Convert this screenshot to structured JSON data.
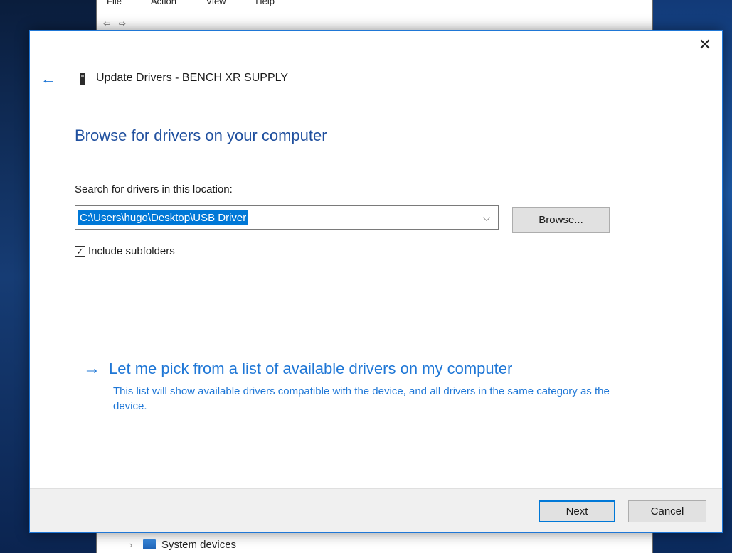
{
  "background_window": {
    "menu": [
      "File",
      "Action",
      "View",
      "Help"
    ],
    "tree_row_label": "System devices"
  },
  "dialog": {
    "title": "Update Drivers - BENCH XR SUPPLY",
    "heading": "Browse for drivers on your computer",
    "search_label": "Search for drivers in this location:",
    "path_value": "C:\\Users\\hugo\\Desktop\\USB Driver",
    "browse_label": "Browse...",
    "include_subfolders_label": "Include subfolders",
    "include_subfolders_checked": true,
    "pick_link_label": "Let me pick from a list of available drivers on my computer",
    "pick_description": "This list will show available drivers compatible with the device, and all drivers in the same category as the device.",
    "next_label": "Next",
    "cancel_label": "Cancel",
    "close_glyph": "✕",
    "back_glyph": "←",
    "arrow_glyph": "→",
    "chevron_glyph": "⌵",
    "check_glyph": "✓"
  },
  "colors": {
    "accent": "#0078d7",
    "heading": "#1f4f9e",
    "link": "#1f77d6"
  }
}
